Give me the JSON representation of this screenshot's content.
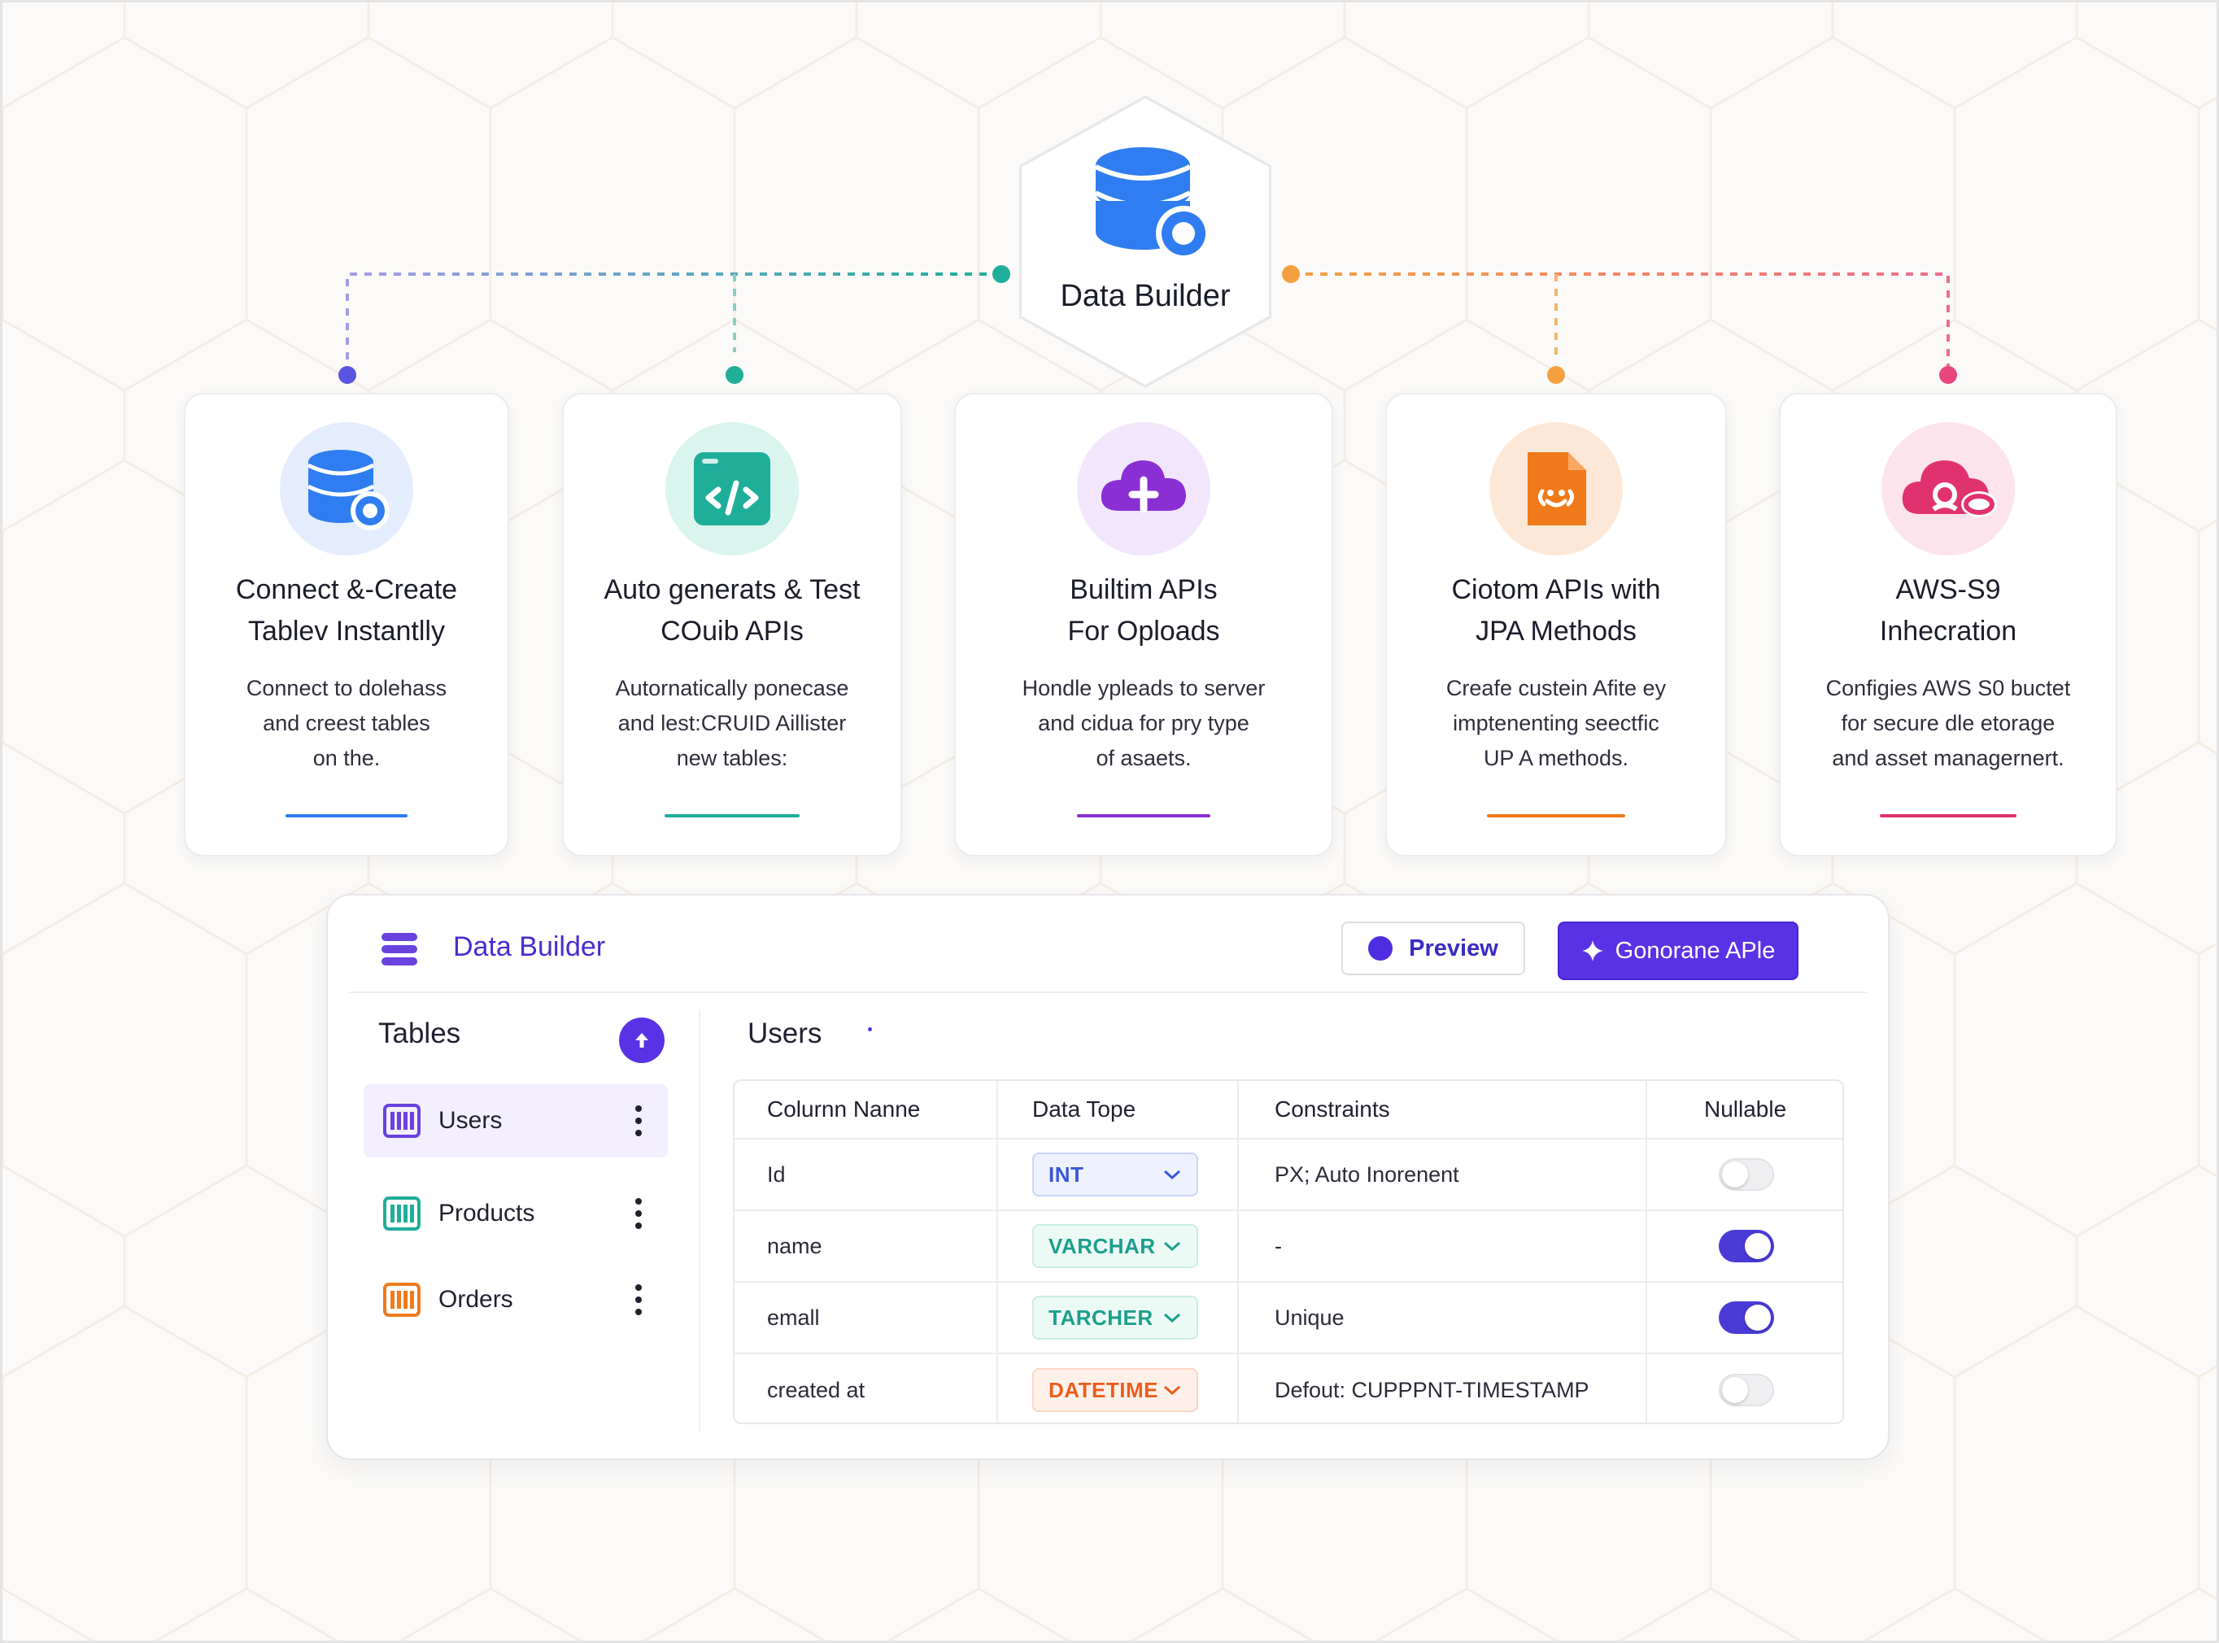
{
  "hub": {
    "title": "Data Builder"
  },
  "features": [
    {
      "title_line1": "Connect &-Create",
      "title_line2": "Tablev Instantlly",
      "desc_line1": "Connect to dolehass",
      "desc_line2": "and creest tables",
      "desc_line3": "on the.",
      "accent": "#2f7df0",
      "icon": "database-icon"
    },
    {
      "title_line1": "Auto generats & Test",
      "title_line2": "COuib APIs",
      "desc_line1": "Autornatically ponecase",
      "desc_line2": "and lest:CRUID Aillister",
      "desc_line3": "new tables:",
      "accent": "#1fae9a",
      "icon": "code-icon"
    },
    {
      "title_line1": "Builtim APIs",
      "title_line2": "For Oploads",
      "desc_line1": "Hondle ypleads to server",
      "desc_line2": "and cidua for pry type",
      "desc_line3": "of asaets.",
      "accent": "#8a2fd4",
      "icon": "cloud-upload-icon"
    },
    {
      "title_line1": "Ciotom APIs with",
      "title_line2": "JPA Methods",
      "desc_line1": "Creafe custein Afite ey",
      "desc_line2": "imptenenting seectfic",
      "desc_line3": "UP A methods.",
      "accent": "#f07a1a",
      "icon": "document-code-icon"
    },
    {
      "title_line1": "AWS-S9",
      "title_line2": "Inhecration",
      "desc_line1": "Configies AWS S0 buctet",
      "desc_line2": "for secure dle etorage",
      "desc_line3": "and asset managernert.",
      "accent": "#e0326e",
      "icon": "cloud-storage-icon"
    }
  ],
  "panel": {
    "title": "Data Builder",
    "preview_label": "Preview",
    "generate_label": "Gonorane APle",
    "tables_label": "Tables",
    "tables": [
      {
        "name": "Users",
        "color": "#6a42e0",
        "active": true
      },
      {
        "name": "Products",
        "color": "#1fae9a",
        "active": false
      },
      {
        "name": "Orders",
        "color": "#f07a1a",
        "active": false
      }
    ],
    "current_table": "Users",
    "columns_header": {
      "column_name": "Colurnn Nanne",
      "data_type": "Data Tope",
      "constraints": "Constraints",
      "nullable": "Nullable"
    },
    "rows": [
      {
        "name": "Id",
        "type": "INT",
        "type_color": "#3a56d8",
        "type_bg": "#eef2fe",
        "constraint": "PX; Auto Inorenent",
        "nullable": false
      },
      {
        "name": "name",
        "type": "VARCHAR",
        "type_color": "#1c9f8c",
        "type_bg": "#ecfaf6",
        "constraint": "-",
        "nullable": true
      },
      {
        "name": "emall",
        "type": "TARCHER",
        "type_color": "#1c9f8c",
        "type_bg": "#ecfaf6",
        "constraint": "Unique",
        "nullable": true
      },
      {
        "name": "created at",
        "type": "DATETIME",
        "type_color": "#ec5d1c",
        "type_bg": "#fff1ea",
        "constraint": "Defout: CUPPPNT-TIMESTAMP",
        "nullable": false
      }
    ]
  }
}
